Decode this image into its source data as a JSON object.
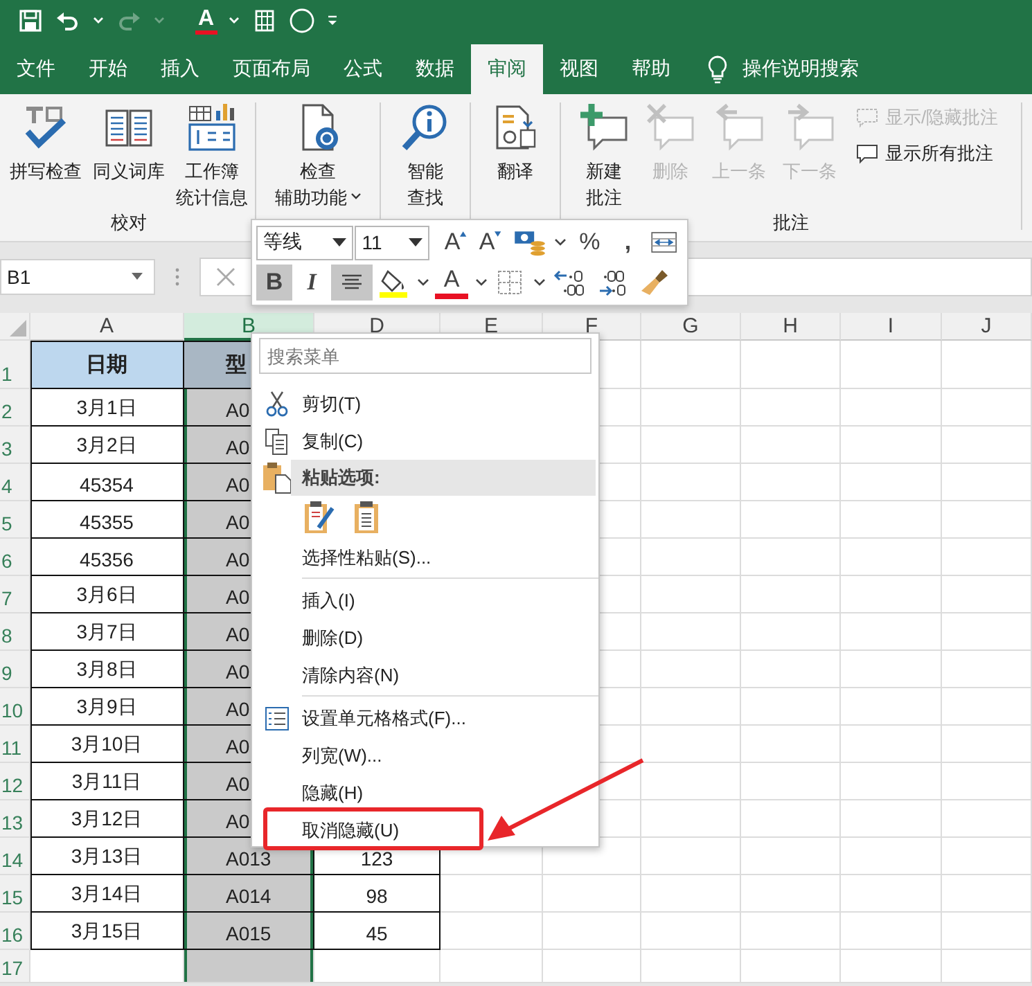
{
  "quick_access": [
    {
      "kind": "save",
      "disabled": false
    },
    {
      "kind": "undo",
      "disabled": false
    },
    {
      "kind": "caret",
      "disabled": false
    },
    {
      "kind": "redo",
      "disabled": true
    },
    {
      "kind": "caret",
      "disabled": true
    },
    {
      "kind": "font-color",
      "text": "A",
      "disabled": false
    },
    {
      "kind": "caret",
      "disabled": false
    },
    {
      "kind": "frame",
      "disabled": false
    },
    {
      "kind": "circle",
      "disabled": false
    },
    {
      "kind": "customize",
      "disabled": false
    }
  ],
  "tabs": [
    {
      "label": "文件",
      "selected": false
    },
    {
      "label": "开始",
      "selected": false
    },
    {
      "label": "插入",
      "selected": false
    },
    {
      "label": "页面布局",
      "selected": false
    },
    {
      "label": "公式",
      "selected": false
    },
    {
      "label": "数据",
      "selected": false
    },
    {
      "label": "审阅",
      "selected": true
    },
    {
      "label": "视图",
      "selected": false
    },
    {
      "label": "帮助",
      "selected": false
    }
  ],
  "tell_me": {
    "text": "操作说明搜索"
  },
  "ribbon": {
    "groups": [
      {
        "label": "校对",
        "buttons": [
          {
            "kind": "spell",
            "lines": [
              "拼写检查"
            ],
            "disabled": false,
            "dropdown": false
          },
          {
            "kind": "thesaurus",
            "lines": [
              "同义词库"
            ],
            "disabled": false,
            "dropdown": false
          },
          {
            "kind": "stats",
            "lines": [
              "工作簿",
              "统计信息"
            ],
            "disabled": false,
            "dropdown": false
          }
        ]
      },
      {
        "buttons": [
          {
            "kind": "accessibility",
            "lines": [
              "检查",
              "辅助功能"
            ],
            "disabled": false,
            "dropdown": true
          }
        ]
      },
      {
        "buttons": [
          {
            "kind": "smart",
            "lines": [
              "智能",
              "查找"
            ],
            "disabled": false,
            "dropdown": false
          }
        ]
      },
      {
        "buttons": [
          {
            "kind": "translate",
            "lines": [
              "翻译"
            ],
            "disabled": false,
            "dropdown": false
          }
        ]
      },
      {
        "label": "批注",
        "buttons": [
          {
            "kind": "new-comment",
            "lines": [
              "新建",
              "批注"
            ],
            "disabled": false,
            "dropdown": false
          },
          {
            "kind": "delete-comment",
            "lines": [
              "删除"
            ],
            "disabled": true,
            "dropdown": false
          },
          {
            "kind": "prev-comment",
            "lines": [
              "上一条"
            ],
            "disabled": true,
            "dropdown": false
          },
          {
            "kind": "next-comment",
            "lines": [
              "下一条"
            ],
            "disabled": true,
            "dropdown": false
          }
        ],
        "small_buttons": [
          {
            "kind": "show-hide",
            "label": "显示/隐藏批注",
            "disabled": true
          },
          {
            "kind": "show-all",
            "label": "显示所有批注",
            "disabled": false
          }
        ]
      }
    ]
  },
  "formula_bar": {
    "name_box": "B1"
  },
  "mini_toolbar": {
    "font": "等线",
    "size": "11",
    "top_buttons": [
      {
        "kind": "grow-font",
        "text": "A",
        "pressed": false
      },
      {
        "kind": "shrink-font",
        "text": "A",
        "pressed": false
      },
      {
        "kind": "accounting",
        "pressed": false
      },
      {
        "kind": "caret",
        "pressed": false
      },
      {
        "kind": "percent",
        "text": "%",
        "pressed": false
      },
      {
        "kind": "comma",
        "text": ",",
        "pressed": false
      },
      {
        "kind": "wrap",
        "pressed": false
      }
    ],
    "bottom_buttons": [
      {
        "kind": "bold",
        "text": "B",
        "pressed": true
      },
      {
        "kind": "italic",
        "text": "I",
        "pressed": false
      },
      {
        "kind": "align-center",
        "pressed": true
      },
      {
        "kind": "fill-color",
        "pressed": false
      },
      {
        "kind": "caret",
        "pressed": false
      },
      {
        "kind": "font-color",
        "text": "A",
        "pressed": false
      },
      {
        "kind": "caret",
        "pressed": false
      },
      {
        "kind": "borders",
        "pressed": false
      },
      {
        "kind": "caret",
        "pressed": false
      },
      {
        "kind": "increase-decimal",
        "pressed": false
      },
      {
        "kind": "decrease-decimal",
        "pressed": false
      },
      {
        "kind": "format-painter",
        "pressed": false
      }
    ]
  },
  "grid": {
    "columns": [
      {
        "letter": "A",
        "selected": false
      },
      {
        "letter": "B",
        "selected": true
      },
      {
        "letter": "D",
        "selected": false
      },
      {
        "letter": "E",
        "selected": false
      },
      {
        "letter": "F",
        "selected": false
      },
      {
        "letter": "G",
        "selected": false
      },
      {
        "letter": "H",
        "selected": false
      },
      {
        "letter": "I",
        "selected": false
      },
      {
        "letter": "J",
        "selected": false
      }
    ],
    "rows": [
      {
        "number": "1",
        "header": true,
        "date": "日期",
        "model": "型"
      },
      {
        "number": "2",
        "date": "3月1日",
        "model": "A0"
      },
      {
        "number": "3",
        "date": "3月2日",
        "model": "A0"
      },
      {
        "number": "4",
        "date": "45354",
        "model": "A0"
      },
      {
        "number": "5",
        "date": "45355",
        "model": "A0"
      },
      {
        "number": "6",
        "date": "45356",
        "model": "A0"
      },
      {
        "number": "7",
        "date": "3月6日",
        "model": "A0"
      },
      {
        "number": "8",
        "date": "3月7日",
        "model": "A0"
      },
      {
        "number": "9",
        "date": "3月8日",
        "model": "A0"
      },
      {
        "number": "10",
        "date": "3月9日",
        "model": "A0"
      },
      {
        "number": "11",
        "date": "3月10日",
        "model": "A0"
      },
      {
        "number": "12",
        "date": "3月11日",
        "model": "A0"
      },
      {
        "number": "13",
        "date": "3月12日",
        "model": "A0"
      },
      {
        "number": "14",
        "date": "3月13日",
        "model": "A013",
        "value": "123"
      },
      {
        "number": "15",
        "date": "3月14日",
        "model": "A014",
        "value": "98"
      },
      {
        "number": "16",
        "date": "3月15日",
        "model": "A015",
        "value": "45"
      },
      {
        "number": "17"
      }
    ]
  },
  "context_menu": {
    "search": {
      "placeholder": "搜索菜单"
    },
    "items": [
      {
        "kind": "cut",
        "label": "剪切(T)",
        "annotated": false
      },
      {
        "kind": "copy",
        "label": "复制(C)",
        "annotated": false
      },
      {
        "kind": "paste-header",
        "label": "粘贴选项:"
      },
      {
        "kind": "paste-options"
      },
      {
        "kind": "item",
        "label": "选择性粘贴(S)...",
        "annotated": false
      },
      {
        "kind": "separator"
      },
      {
        "kind": "item",
        "label": "插入(I)",
        "annotated": false
      },
      {
        "kind": "item",
        "label": "删除(D)",
        "annotated": false
      },
      {
        "kind": "item",
        "label": "清除内容(N)",
        "annotated": false
      },
      {
        "kind": "separator"
      },
      {
        "kind": "format-cells",
        "label": "设置单元格格式(F)...",
        "annotated": false
      },
      {
        "kind": "item",
        "label": "列宽(W)...",
        "annotated": false
      },
      {
        "kind": "item",
        "label": "隐藏(H)",
        "annotated": false
      },
      {
        "kind": "item",
        "label": "取消隐藏(U)",
        "annotated": true
      }
    ]
  }
}
